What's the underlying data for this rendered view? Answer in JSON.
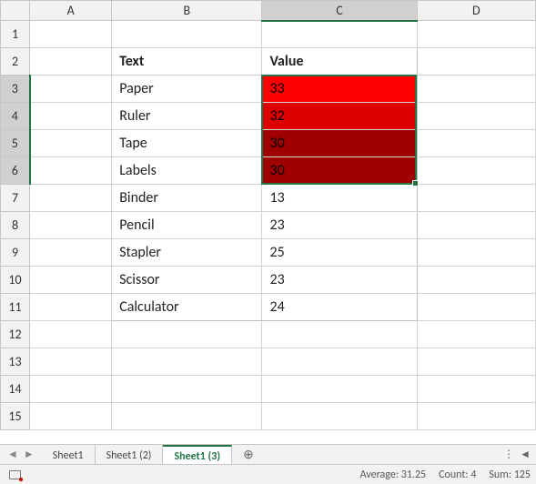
{
  "columns": [
    "A",
    "B",
    "C",
    "D"
  ],
  "row_count": 15,
  "header": {
    "text_label": "Text",
    "value_label": "Value"
  },
  "data_rows": [
    {
      "text": "Paper",
      "value": 33,
      "bg": "#fe0000",
      "sel": true
    },
    {
      "text": "Ruler",
      "value": 32,
      "bg": "#de0000",
      "sel": true
    },
    {
      "text": "Tape",
      "value": 30,
      "bg": "#9f0101",
      "sel": true
    },
    {
      "text": "Labels",
      "value": 30,
      "bg": "#9f0101",
      "sel": true
    },
    {
      "text": "Binder",
      "value": 13,
      "bg": "",
      "sel": false
    },
    {
      "text": "Pencil",
      "value": 23,
      "bg": "",
      "sel": false
    },
    {
      "text": "Stapler",
      "value": 25,
      "bg": "",
      "sel": false
    },
    {
      "text": "Scissor",
      "value": 23,
      "bg": "",
      "sel": false
    },
    {
      "text": "Calculator",
      "value": 24,
      "bg": "",
      "sel": false
    }
  ],
  "selection": {
    "col": "C",
    "row_start": 3,
    "row_end": 6
  },
  "tabs": [
    {
      "label": "Sheet1",
      "active": false
    },
    {
      "label": "Sheet1 (2)",
      "active": false
    },
    {
      "label": "Sheet1 (3)",
      "active": true
    }
  ],
  "status": {
    "average_label": "Average:",
    "average_value": "31.25",
    "count_label": "Count:",
    "count_value": "4",
    "sum_label": "Sum:",
    "sum_value": "125"
  },
  "chart_data": {
    "type": "table",
    "columns": [
      "Text",
      "Value"
    ],
    "rows": [
      [
        "Paper",
        33
      ],
      [
        "Ruler",
        32
      ],
      [
        "Tape",
        30
      ],
      [
        "Labels",
        30
      ],
      [
        "Binder",
        13
      ],
      [
        "Pencil",
        23
      ],
      [
        "Stapler",
        25
      ],
      [
        "Scissor",
        23
      ],
      [
        "Calculator",
        24
      ]
    ]
  }
}
